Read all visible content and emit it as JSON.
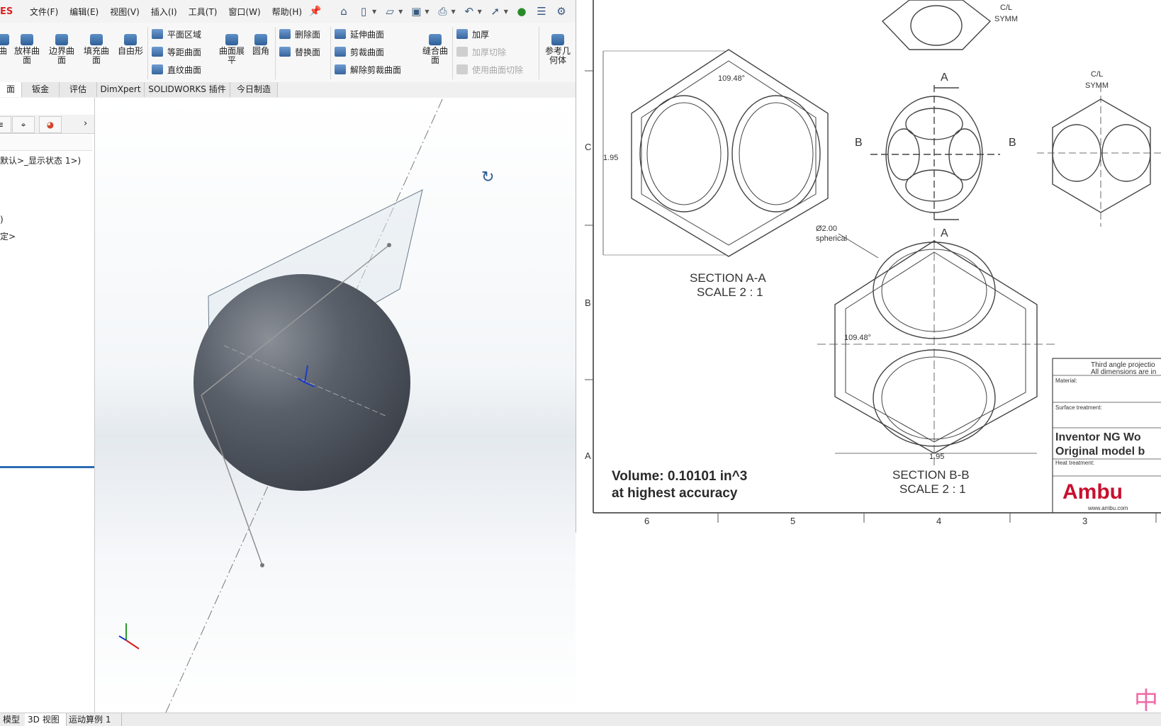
{
  "menubar": {
    "logo": "ES",
    "menus": [
      "文件(F)",
      "编辑(E)",
      "视图(V)",
      "插入(I)",
      "工具(T)",
      "窗口(W)",
      "帮助(H)"
    ]
  },
  "ribbon": {
    "big": [
      {
        "label": "曲",
        "name": "surface-sweep"
      },
      {
        "label": "放样曲面",
        "name": "loft-surface"
      },
      {
        "label": "边界曲面",
        "name": "boundary-surface"
      },
      {
        "label": "填充曲面",
        "name": "fill-surface"
      },
      {
        "label": "自由形",
        "name": "freeform"
      },
      {
        "label": "曲面展平",
        "name": "surface-flatten"
      },
      {
        "label": "圆角",
        "name": "fillet"
      },
      {
        "label": "缝合曲面",
        "name": "knit-surface"
      },
      {
        "label": "参考几何体",
        "name": "reference-geometry"
      }
    ],
    "col1": [
      "平面区域",
      "等距曲面",
      "直纹曲面"
    ],
    "col2": [
      "删除面",
      "替换面"
    ],
    "col3": [
      "延伸曲面",
      "剪裁曲面",
      "解除剪裁曲面"
    ],
    "col4": [
      "加厚",
      "加厚切除",
      "使用曲面切除"
    ]
  },
  "cmdtabs": [
    "面",
    "钣金",
    "评估",
    "DimXpert",
    "SOLIDWORKS 插件",
    "今日制造"
  ],
  "leftpanel": {
    "config": "默认>_显示状态 1>)",
    "line2": ")",
    "line3": "定>"
  },
  "drawing": {
    "volume_line1": "Volume: 0.10101 in^3",
    "volume_line2": "at highest accuracy",
    "section_aa": "SECTION  A-A",
    "scale_aa": "SCALE 2 : 1",
    "section_bb": "SECTION  B-B",
    "scale_bb": "SCALE 2 : 1",
    "angle": "109.48°",
    "dim_height": "1.95",
    "dim_width": "1.95",
    "sphere_dim": "Ø2.00",
    "sphere_note": "spherical",
    "cl_symm_top": "C/L",
    "cl_symm_top2": "SYMM",
    "label_a": "A",
    "label_b": "B",
    "row_c": "C",
    "row_b": "B",
    "row_a": "A",
    "col_6": "6",
    "col_5": "5",
    "col_4": "4",
    "col_3": "3",
    "title_proj": "Third angle projectio",
    "title_dims": "All dimensions are in",
    "title_material": "Material:",
    "title_surface": "Surface treatment:",
    "title_heat": "Heat treatment:",
    "title_line1": "Inventor NG Wo",
    "title_line2": "Original model b",
    "brand": "Ambu",
    "brand_url": "www.ambu.com"
  },
  "statusbar": [
    "模型",
    "3D 视图",
    "运动算例 1"
  ],
  "ime_char": "中"
}
